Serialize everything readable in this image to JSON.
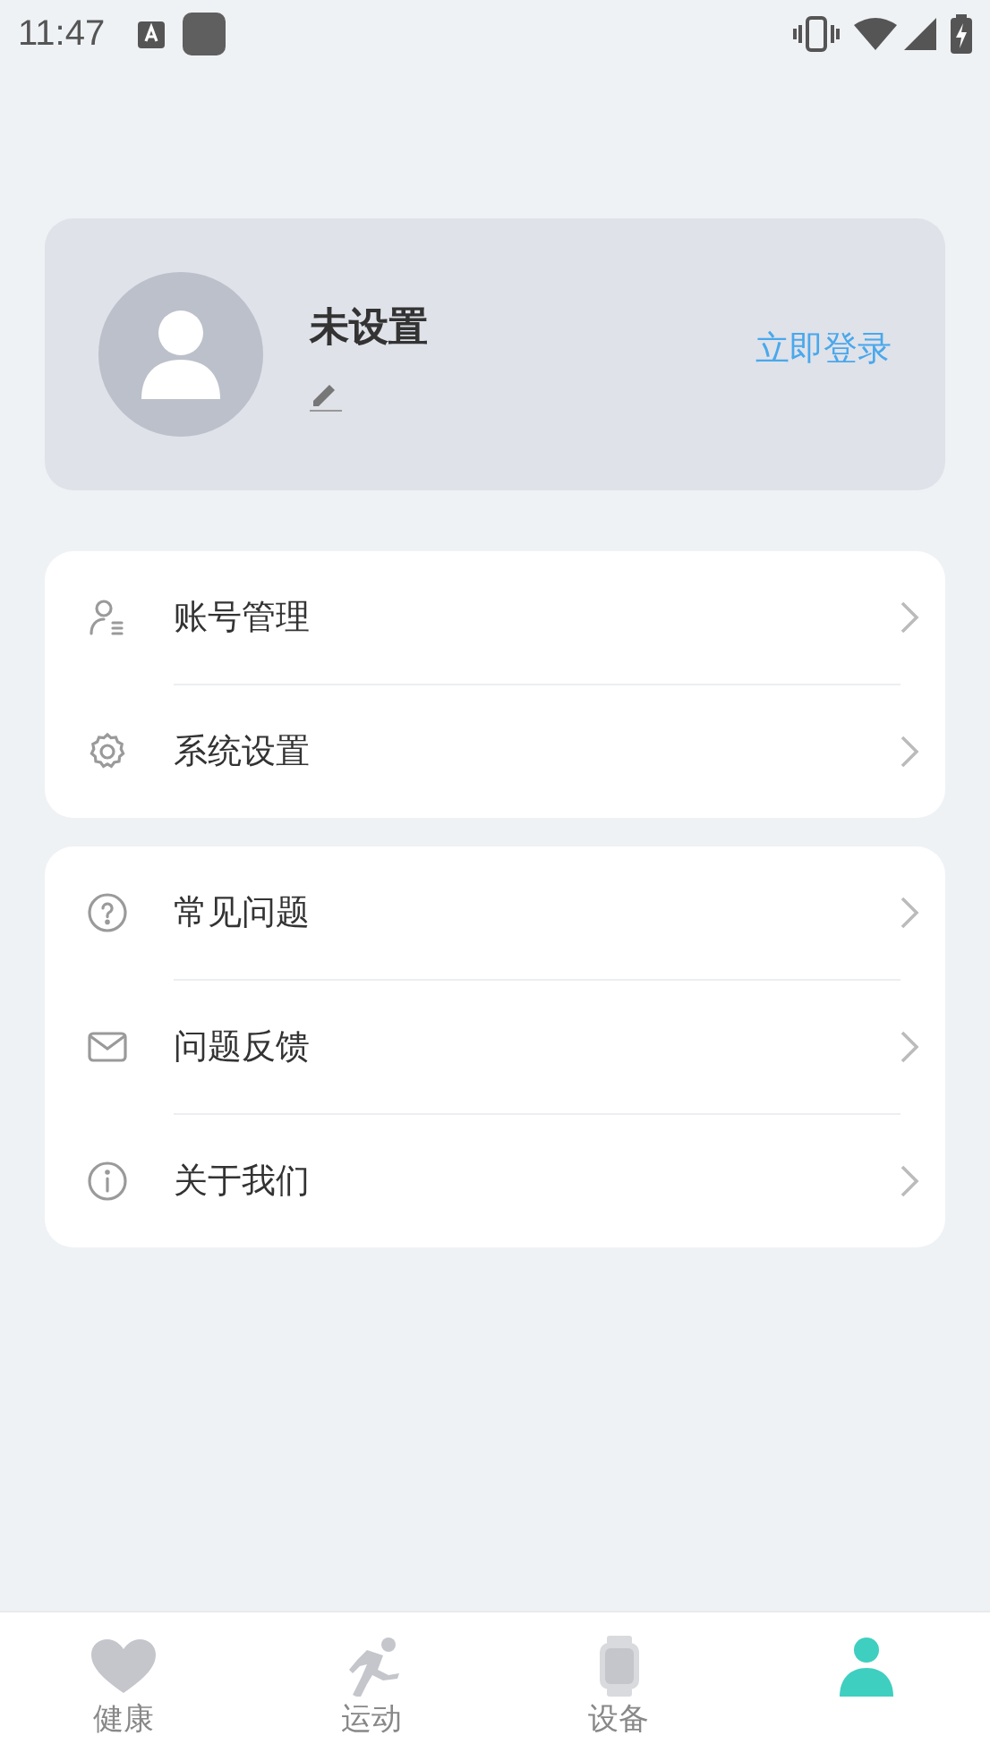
{
  "status_bar": {
    "time": "11:47"
  },
  "profile": {
    "name": "未设置",
    "login": "立即登录"
  },
  "menu_groups": [
    {
      "items": [
        {
          "label": "账号管理",
          "kind": "account"
        },
        {
          "label": "系统设置",
          "kind": "settings"
        }
      ]
    },
    {
      "items": [
        {
          "label": "常见问题",
          "kind": "help"
        },
        {
          "label": "问题反馈",
          "kind": "mail"
        },
        {
          "label": "关于我们",
          "kind": "info"
        }
      ]
    }
  ],
  "tabs": [
    {
      "label": "健康",
      "kind": "heart",
      "selected": false
    },
    {
      "label": "运动",
      "kind": "run",
      "selected": false
    },
    {
      "label": "设备",
      "kind": "watch",
      "selected": false
    },
    {
      "kind": "person",
      "selected": true
    }
  ]
}
